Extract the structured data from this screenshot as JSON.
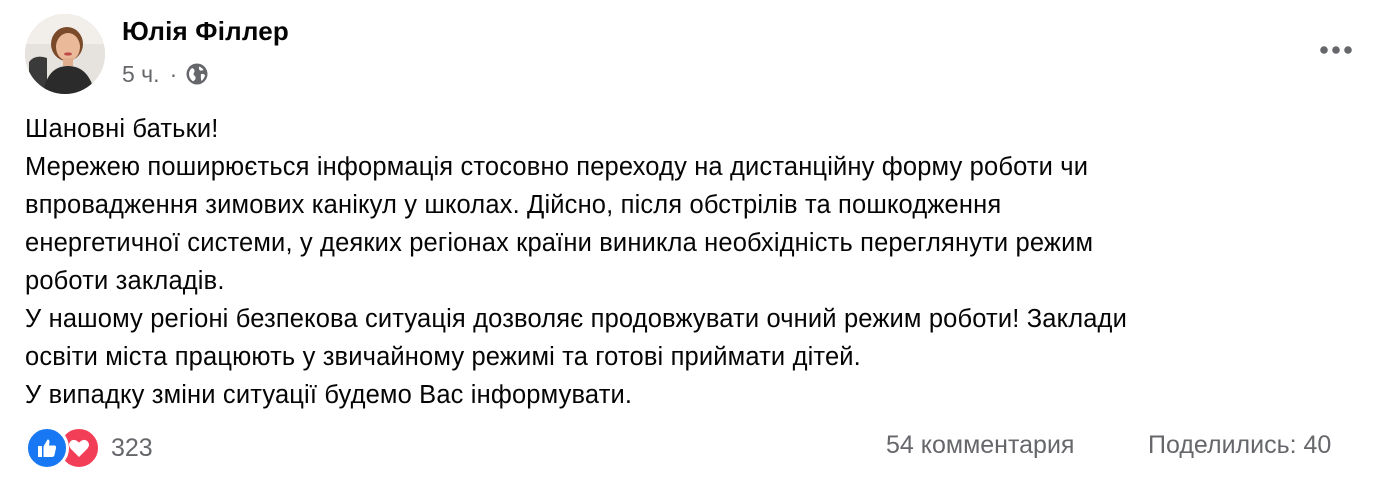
{
  "post": {
    "author": "Юлія Філлер",
    "timestamp": "5 ч.",
    "separator": "·",
    "audience_icon": "globe-icon",
    "menu_icon": "more-horizontal-icon",
    "text_lines": [
      "Шановні батьки!",
      "Мережею поширюється інформація стосовно переходу на дистанційну форму роботи чи",
      "впровадження зимових канікул у школах. Дійсно, після обстрілів та пошкодження",
      "енергетичної системи, у деяких регіонах країни виникла необхідність переглянути режим",
      "роботи закладів.",
      "У нашому регіоні безпекова ситуація дозволяє продовжувати очний режим роботи! Заклади",
      "освіти міста працюють у звичайному режимі та готові приймати дітей.",
      "У випадку зміни ситуації будемо Вас інформувати."
    ]
  },
  "footer": {
    "reactions": [
      "like-icon",
      "love-icon"
    ],
    "reaction_count": "323",
    "comments": "54 комментария",
    "shares": "Поделились: 40"
  },
  "colors": {
    "like": "#1877f2",
    "love": "#f33e58",
    "secondary_text": "#65676b",
    "primary_text": "#050505"
  }
}
